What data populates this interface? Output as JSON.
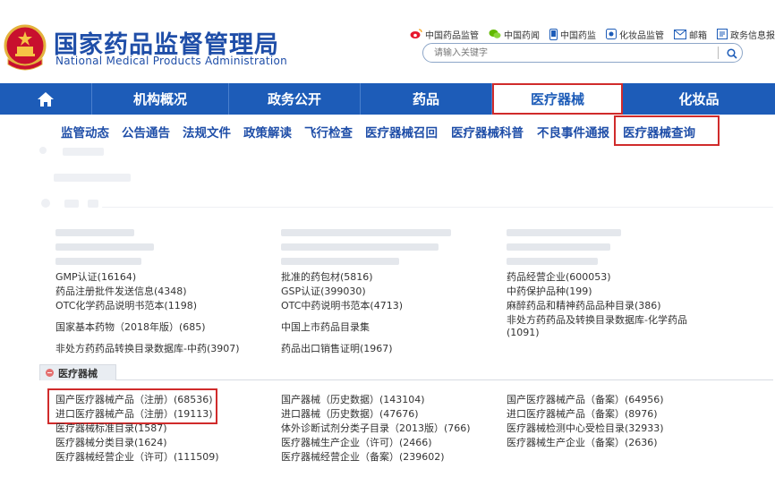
{
  "header": {
    "brand_cn": "国家药品监督管理局",
    "brand_en": "National Medical Products Administration",
    "links": [
      {
        "label": "中国药品监管",
        "icon": "weibo-icon"
      },
      {
        "label": "中国药闻",
        "icon": "wechat-icon"
      },
      {
        "label": "中国药监",
        "icon": "mobile-icon"
      },
      {
        "label": "化妆品监管",
        "icon": "app-icon"
      },
      {
        "label": "邮箱",
        "icon": "mail-icon"
      },
      {
        "label": "政务信息报送",
        "icon": "report-icon"
      }
    ],
    "search": {
      "placeholder": "请输入关键字"
    }
  },
  "nav": {
    "items": [
      {
        "label": "",
        "icon": "home-icon"
      },
      {
        "label": "机构概况"
      },
      {
        "label": "政务公开"
      },
      {
        "label": "药品"
      },
      {
        "label": "医疗器械",
        "active": true
      },
      {
        "label": "化妆品"
      }
    ]
  },
  "subnav": {
    "items": [
      "监管动态",
      "公告通告",
      "法规文件",
      "政策解读",
      "飞行检查",
      "医疗器械召回",
      "医疗器械科普",
      "不良事件通报",
      "医疗器械查询"
    ]
  },
  "drug_list": {
    "col1": [
      "GMP认证(16164)",
      "药品注册批件发送信息(4348)",
      "OTC化学药品说明书范本(1198)",
      "国家基本药物（2018年版）(685)",
      "非处方药药品转换目录数据库-中药(3907)"
    ],
    "col2": [
      "批准的药包材(5816)",
      "GSP认证(399030)",
      "OTC中药说明书范本(4713)",
      "中国上市药品目录集",
      "药品出口销售证明(1967)"
    ],
    "col3": [
      "药品经营企业(600053)",
      "中药保护品种(199)",
      "麻醉药品和精神药品品种目录(386)",
      "非处方药药品及转换目录数据库-化学药品",
      "(1091)"
    ]
  },
  "device_section": {
    "title": "医疗器械",
    "col1": [
      "国产医疗器械产品（注册）(68536)",
      "进口医疗器械产品（注册）(19113)",
      "医疗器械标准目录(1587)",
      "医疗器械分类目录(1624)",
      "医疗器械经营企业（许可）(111509)"
    ],
    "col2": [
      "国产器械（历史数据）(143104)",
      "进口器械（历史数据）(47676)",
      "体外诊断试剂分类子目录（2013版）(766)",
      "医疗器械生产企业（许可）(2466)",
      "医疗器械经营企业（备案）(239602)"
    ],
    "col3": [
      "国产医疗器械产品（备案）(64956)",
      "进口医疗器械产品（备案）(8976)",
      "医疗器械检测中心受检目录(32933)",
      "医疗器械生产企业（备案）(2636)"
    ]
  },
  "colors": {
    "nav_blue": "#1d5cb8",
    "highlight_red": "#d02b2b",
    "brand_blue": "#1f4ea8"
  }
}
